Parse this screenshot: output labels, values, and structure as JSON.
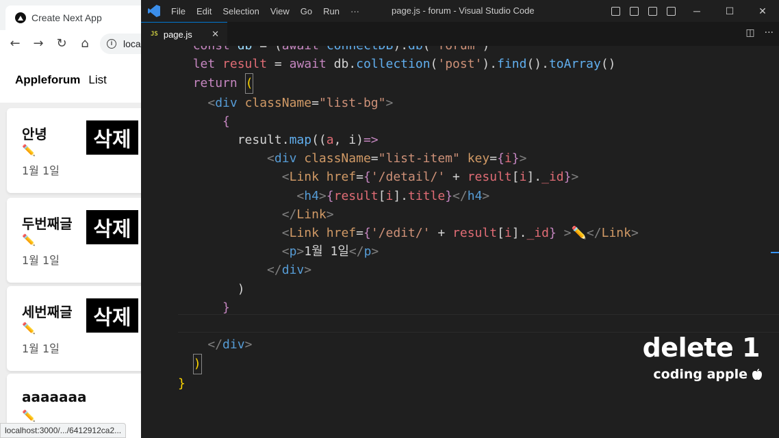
{
  "browser": {
    "tab_title": "Create Next App",
    "address_text": "loca",
    "nav": {
      "brand": "Appleforum",
      "list_link": "List"
    },
    "cards": [
      {
        "title": "안녕",
        "edit_icon": "✏️",
        "date": "1월 1일",
        "delete_label": "삭제"
      },
      {
        "title": "두번째글",
        "edit_icon": "✏️",
        "date": "1월 1일",
        "delete_label": "삭제"
      },
      {
        "title": "세번째글",
        "edit_icon": "✏️",
        "date": "1월 1일",
        "delete_label": "삭제"
      },
      {
        "title": "aaaaaaa",
        "edit_icon": "✏️",
        "date": "",
        "delete_label": ""
      }
    ],
    "status_url": "localhost:3000/.../6412912ca2..."
  },
  "vscode": {
    "menu": [
      "File",
      "Edit",
      "Selection",
      "View",
      "Go",
      "Run",
      "···"
    ],
    "window_title": "page.js - forum - Visual Studio Code",
    "tab": {
      "icon_text": "JS",
      "name": "page.js"
    },
    "accent": "#0078d4"
  },
  "watermark": {
    "title": "delete 1",
    "subtitle": "coding apple"
  }
}
